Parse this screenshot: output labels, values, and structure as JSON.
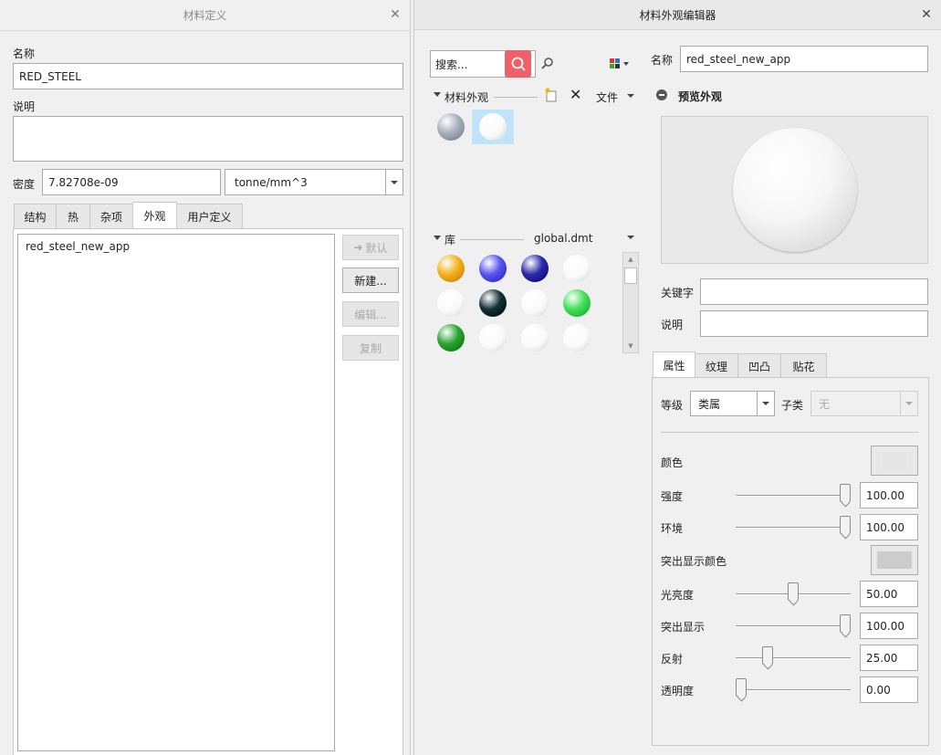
{
  "left_dialog": {
    "title": "材料定义",
    "name_label": "名称",
    "name_value": "RED_STEEL",
    "desc_label": "说明",
    "desc_value": "",
    "density_label": "密度",
    "density_value": "7.82708e-09",
    "density_unit": "tonne/mm^3",
    "tabs": [
      {
        "label": "结构",
        "active": false
      },
      {
        "label": "热",
        "active": false
      },
      {
        "label": "杂项",
        "active": false
      },
      {
        "label": "外观",
        "active": true
      },
      {
        "label": "用户定义",
        "active": false
      }
    ],
    "appearance_list": [
      "red_steel_new_app"
    ],
    "buttons": {
      "default": "默认",
      "new": "新建...",
      "edit": "编辑...",
      "copy": "复制"
    }
  },
  "right_dialog": {
    "title": "材料外观编辑器",
    "search_placeholder": "搜索...",
    "material_appearance_label": "材料外观",
    "file_label": "文件",
    "library_label": "库",
    "library_file": "global.dmt",
    "name_label": "名称",
    "name_value": "red_steel_new_app",
    "preview_label": "预览外观",
    "keyword_label": "关键字",
    "keyword_value": "",
    "desc_label": "说明",
    "desc_value": "",
    "tabs": [
      {
        "label": "属性",
        "active": true
      },
      {
        "label": "纹理",
        "active": false
      },
      {
        "label": "凹凸",
        "active": false
      },
      {
        "label": "贴花",
        "active": false
      }
    ],
    "class_label": "等级",
    "class_value": "类属",
    "subclass_label": "子类",
    "subclass_value": "无",
    "color_label": "颜色",
    "color_value": "#e6e6e6",
    "highlight_color_label": "突出显示颜色",
    "highlight_color_value": "#cccccc",
    "properties": [
      {
        "label": "强度",
        "value": "100.00",
        "fraction": 1.0
      },
      {
        "label": "环境",
        "value": "100.00",
        "fraction": 1.0
      },
      {
        "label": "光亮度",
        "value": "50.00",
        "fraction": 0.5
      },
      {
        "label": "突出显示",
        "value": "100.00",
        "fraction": 1.0
      },
      {
        "label": "反射",
        "value": "25.00",
        "fraction": 0.25
      },
      {
        "label": "透明度",
        "value": "0.00",
        "fraction": 0.0
      }
    ],
    "material_swatches": [
      "#a8b0bc",
      "#ffffff"
    ],
    "library_swatches": [
      "#f4b21b",
      "#5a55f0",
      "#2b2ba8",
      "#ffffff",
      "#ffffff",
      "#13323a",
      "#ffffff",
      "#44e05a",
      "#2aa532",
      "#ffffff",
      "#ffffff",
      "#ffffff"
    ]
  }
}
